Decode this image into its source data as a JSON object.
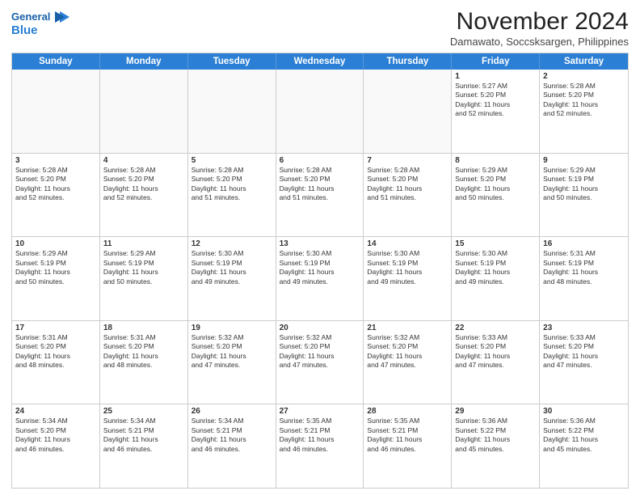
{
  "logo": {
    "line1": "General",
    "line2": "Blue",
    "icon": "▶"
  },
  "title": "November 2024",
  "location": "Damawato, Soccsksargen, Philippines",
  "header_days": [
    "Sunday",
    "Monday",
    "Tuesday",
    "Wednesday",
    "Thursday",
    "Friday",
    "Saturday"
  ],
  "weeks": [
    [
      {
        "day": "",
        "text": ""
      },
      {
        "day": "",
        "text": ""
      },
      {
        "day": "",
        "text": ""
      },
      {
        "day": "",
        "text": ""
      },
      {
        "day": "",
        "text": ""
      },
      {
        "day": "1",
        "text": "Sunrise: 5:27 AM\nSunset: 5:20 PM\nDaylight: 11 hours\nand 52 minutes."
      },
      {
        "day": "2",
        "text": "Sunrise: 5:28 AM\nSunset: 5:20 PM\nDaylight: 11 hours\nand 52 minutes."
      }
    ],
    [
      {
        "day": "3",
        "text": "Sunrise: 5:28 AM\nSunset: 5:20 PM\nDaylight: 11 hours\nand 52 minutes."
      },
      {
        "day": "4",
        "text": "Sunrise: 5:28 AM\nSunset: 5:20 PM\nDaylight: 11 hours\nand 52 minutes."
      },
      {
        "day": "5",
        "text": "Sunrise: 5:28 AM\nSunset: 5:20 PM\nDaylight: 11 hours\nand 51 minutes."
      },
      {
        "day": "6",
        "text": "Sunrise: 5:28 AM\nSunset: 5:20 PM\nDaylight: 11 hours\nand 51 minutes."
      },
      {
        "day": "7",
        "text": "Sunrise: 5:28 AM\nSunset: 5:20 PM\nDaylight: 11 hours\nand 51 minutes."
      },
      {
        "day": "8",
        "text": "Sunrise: 5:29 AM\nSunset: 5:20 PM\nDaylight: 11 hours\nand 50 minutes."
      },
      {
        "day": "9",
        "text": "Sunrise: 5:29 AM\nSunset: 5:19 PM\nDaylight: 11 hours\nand 50 minutes."
      }
    ],
    [
      {
        "day": "10",
        "text": "Sunrise: 5:29 AM\nSunset: 5:19 PM\nDaylight: 11 hours\nand 50 minutes."
      },
      {
        "day": "11",
        "text": "Sunrise: 5:29 AM\nSunset: 5:19 PM\nDaylight: 11 hours\nand 50 minutes."
      },
      {
        "day": "12",
        "text": "Sunrise: 5:30 AM\nSunset: 5:19 PM\nDaylight: 11 hours\nand 49 minutes."
      },
      {
        "day": "13",
        "text": "Sunrise: 5:30 AM\nSunset: 5:19 PM\nDaylight: 11 hours\nand 49 minutes."
      },
      {
        "day": "14",
        "text": "Sunrise: 5:30 AM\nSunset: 5:19 PM\nDaylight: 11 hours\nand 49 minutes."
      },
      {
        "day": "15",
        "text": "Sunrise: 5:30 AM\nSunset: 5:19 PM\nDaylight: 11 hours\nand 49 minutes."
      },
      {
        "day": "16",
        "text": "Sunrise: 5:31 AM\nSunset: 5:19 PM\nDaylight: 11 hours\nand 48 minutes."
      }
    ],
    [
      {
        "day": "17",
        "text": "Sunrise: 5:31 AM\nSunset: 5:20 PM\nDaylight: 11 hours\nand 48 minutes."
      },
      {
        "day": "18",
        "text": "Sunrise: 5:31 AM\nSunset: 5:20 PM\nDaylight: 11 hours\nand 48 minutes."
      },
      {
        "day": "19",
        "text": "Sunrise: 5:32 AM\nSunset: 5:20 PM\nDaylight: 11 hours\nand 47 minutes."
      },
      {
        "day": "20",
        "text": "Sunrise: 5:32 AM\nSunset: 5:20 PM\nDaylight: 11 hours\nand 47 minutes."
      },
      {
        "day": "21",
        "text": "Sunrise: 5:32 AM\nSunset: 5:20 PM\nDaylight: 11 hours\nand 47 minutes."
      },
      {
        "day": "22",
        "text": "Sunrise: 5:33 AM\nSunset: 5:20 PM\nDaylight: 11 hours\nand 47 minutes."
      },
      {
        "day": "23",
        "text": "Sunrise: 5:33 AM\nSunset: 5:20 PM\nDaylight: 11 hours\nand 47 minutes."
      }
    ],
    [
      {
        "day": "24",
        "text": "Sunrise: 5:34 AM\nSunset: 5:20 PM\nDaylight: 11 hours\nand 46 minutes."
      },
      {
        "day": "25",
        "text": "Sunrise: 5:34 AM\nSunset: 5:21 PM\nDaylight: 11 hours\nand 46 minutes."
      },
      {
        "day": "26",
        "text": "Sunrise: 5:34 AM\nSunset: 5:21 PM\nDaylight: 11 hours\nand 46 minutes."
      },
      {
        "day": "27",
        "text": "Sunrise: 5:35 AM\nSunset: 5:21 PM\nDaylight: 11 hours\nand 46 minutes."
      },
      {
        "day": "28",
        "text": "Sunrise: 5:35 AM\nSunset: 5:21 PM\nDaylight: 11 hours\nand 46 minutes."
      },
      {
        "day": "29",
        "text": "Sunrise: 5:36 AM\nSunset: 5:22 PM\nDaylight: 11 hours\nand 45 minutes."
      },
      {
        "day": "30",
        "text": "Sunrise: 5:36 AM\nSunset: 5:22 PM\nDaylight: 11 hours\nand 45 minutes."
      }
    ]
  ]
}
